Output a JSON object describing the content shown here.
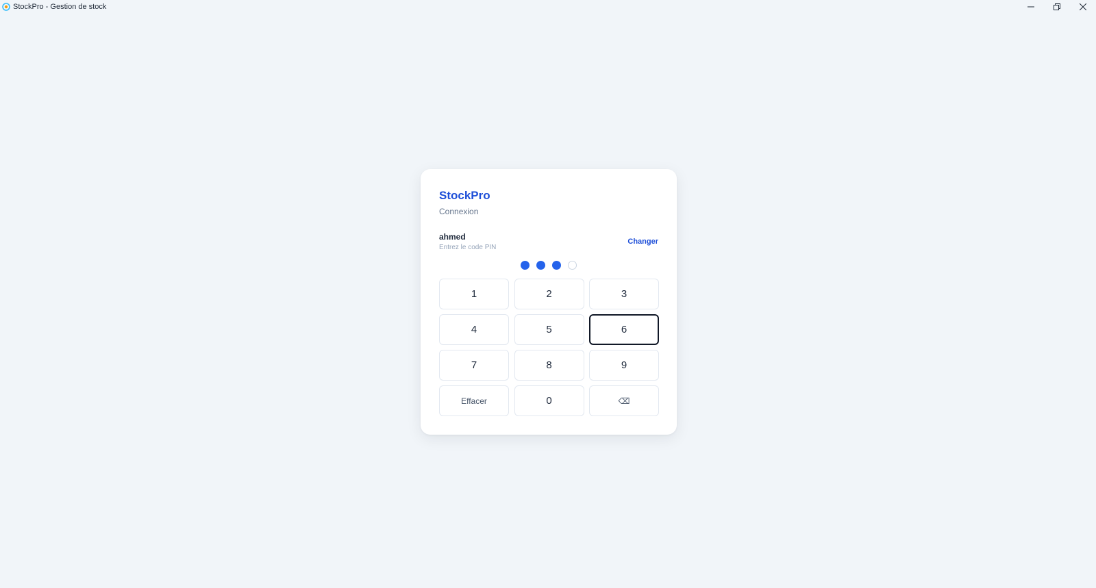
{
  "window": {
    "title": "StockPro - Gestion de stock",
    "icon": "app-logo-icon",
    "controls": [
      "minimize-icon",
      "restore-icon",
      "close-icon"
    ]
  },
  "login": {
    "brand": "StockPro",
    "subtitle": "Connexion",
    "user_name": "ahmed",
    "pin_hint": "Entrez le code PIN",
    "change_label": "Changer",
    "pin_length": 4,
    "pin_filled": 3
  },
  "keypad": {
    "k1": "1",
    "k2": "2",
    "k3": "3",
    "k4": "4",
    "k5": "5",
    "k6": "6",
    "k7": "7",
    "k8": "8",
    "k9": "9",
    "clear": "Effacer",
    "k0": "0",
    "backspace": "⌫",
    "focused_key": "6"
  },
  "colors": {
    "accent": "#2563eb",
    "brand": "#1d4ed8",
    "background": "#f1f5f9"
  }
}
